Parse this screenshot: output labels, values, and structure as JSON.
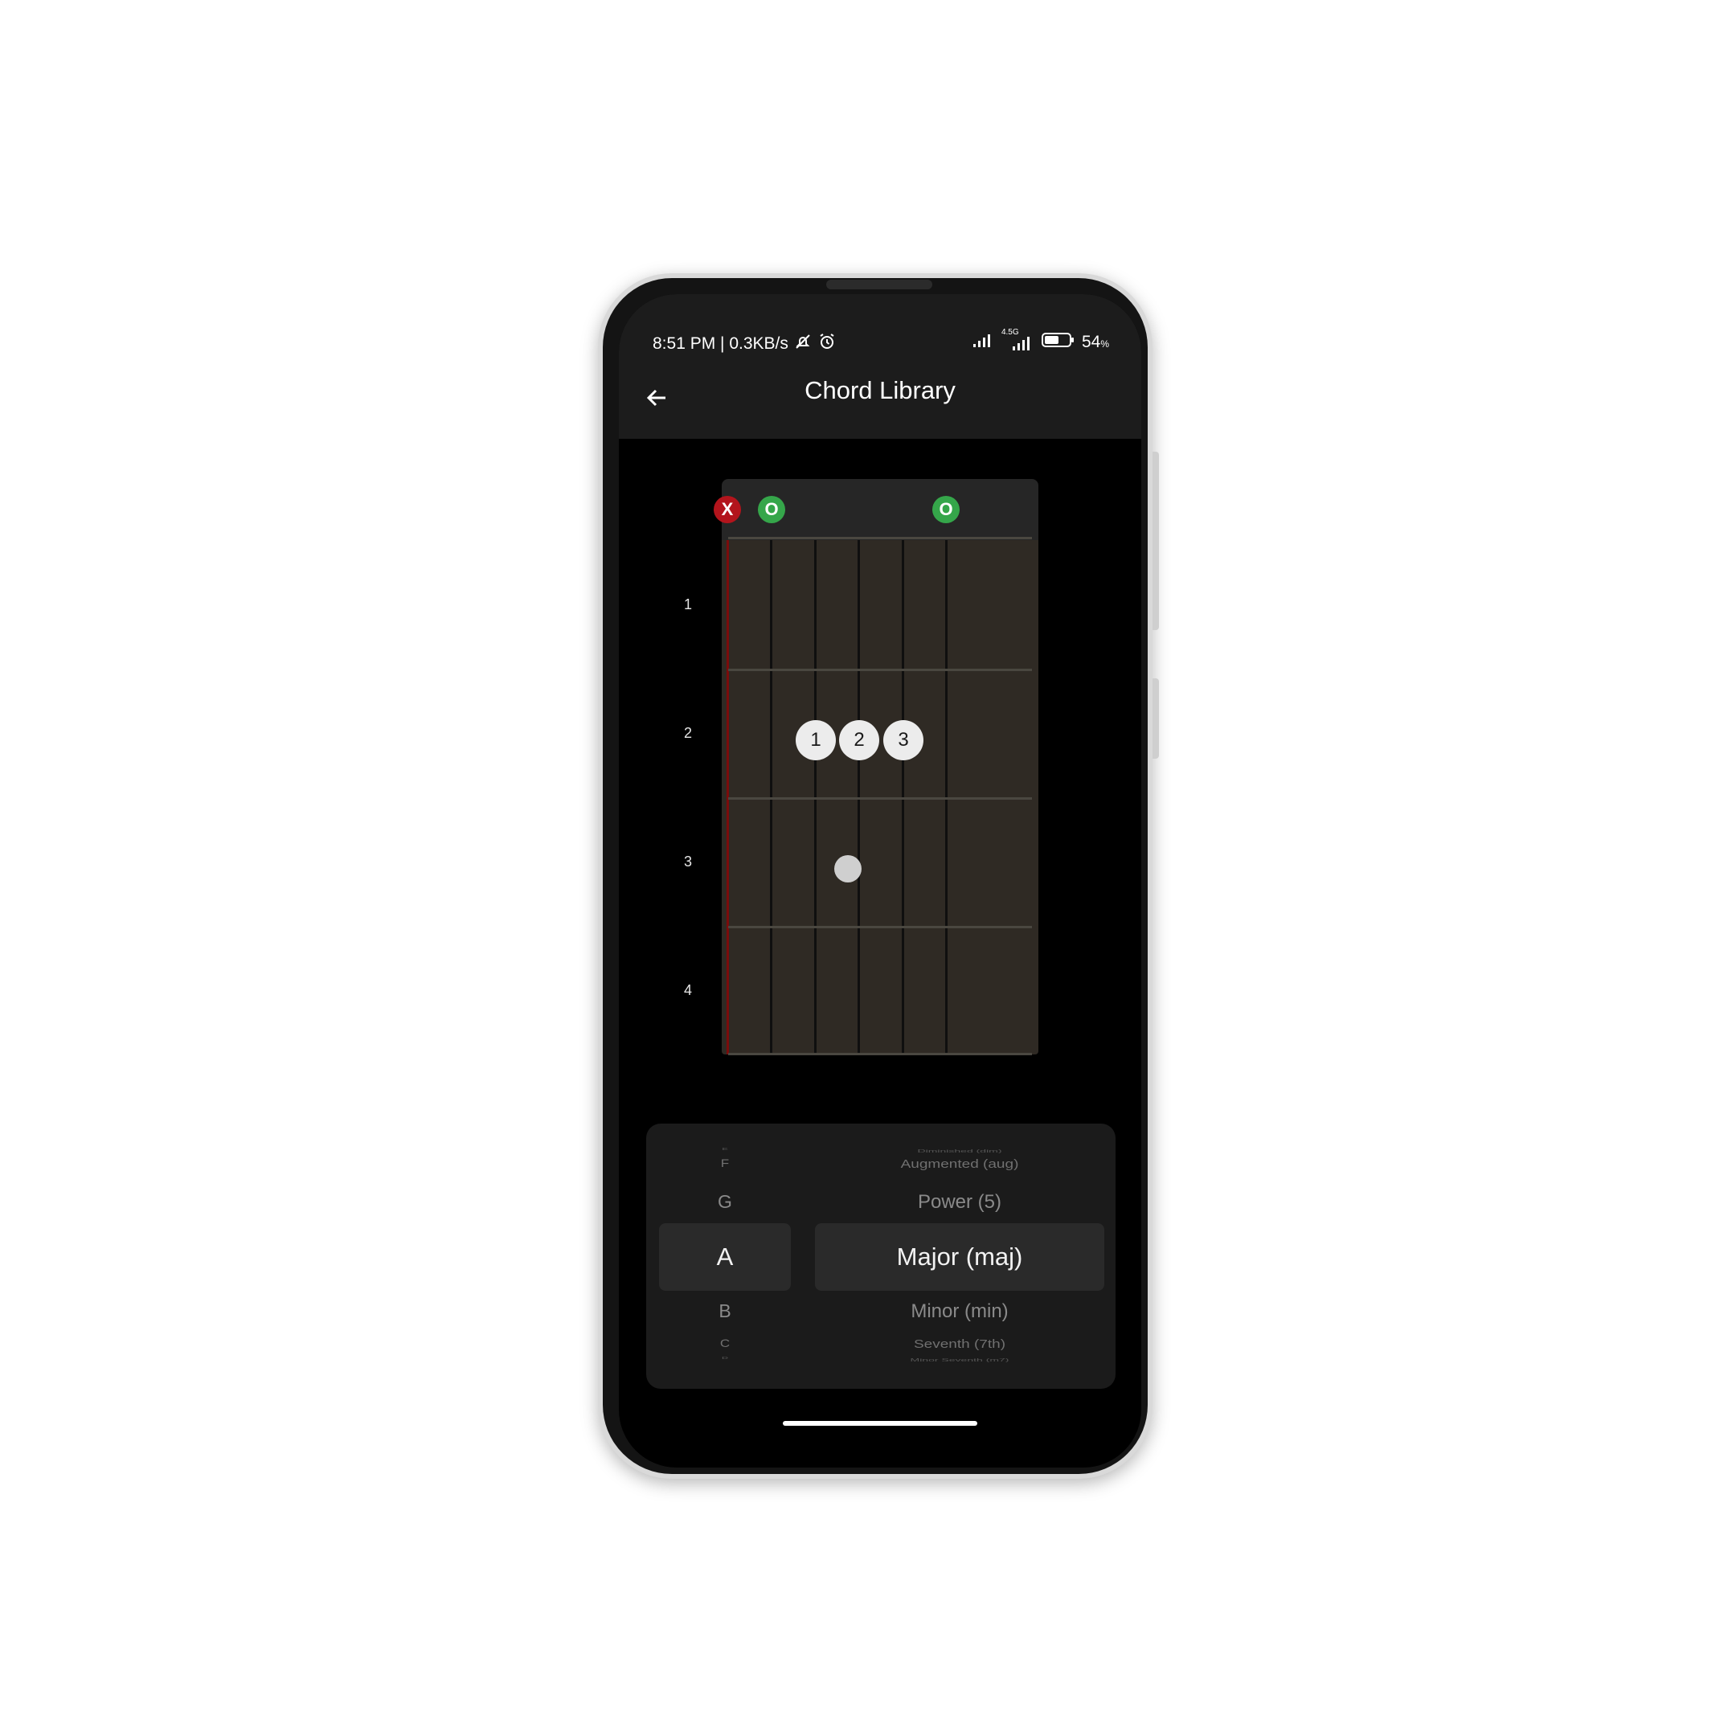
{
  "status_bar": {
    "time_speed": "8:51 PM | 0.3KB/s",
    "network_label": "4.5G",
    "battery_percent": "54",
    "battery_unit": "%"
  },
  "app_bar": {
    "title": "Chord Library"
  },
  "chord_diagram": {
    "fret_numbers": [
      "1",
      "2",
      "3",
      "4"
    ],
    "string_markers": {
      "muted": "X",
      "open": "O"
    },
    "fingers": [
      "1",
      "2",
      "3"
    ]
  },
  "picker": {
    "root_notes": [
      "E",
      "F",
      "G",
      "A",
      "B",
      "C",
      "D"
    ],
    "selected_root": "A",
    "chord_types": [
      "Diminished (dim)",
      "Augmented (aug)",
      "Power (5)",
      "Major (maj)",
      "Minor (min)",
      "Seventh (7th)",
      "Minor Seventh (m7)"
    ],
    "selected_type": "Major (maj)"
  },
  "colors": {
    "muted_marker": "#b3141c",
    "open_marker": "#35a64a",
    "fretboard": "#2f2a24"
  }
}
